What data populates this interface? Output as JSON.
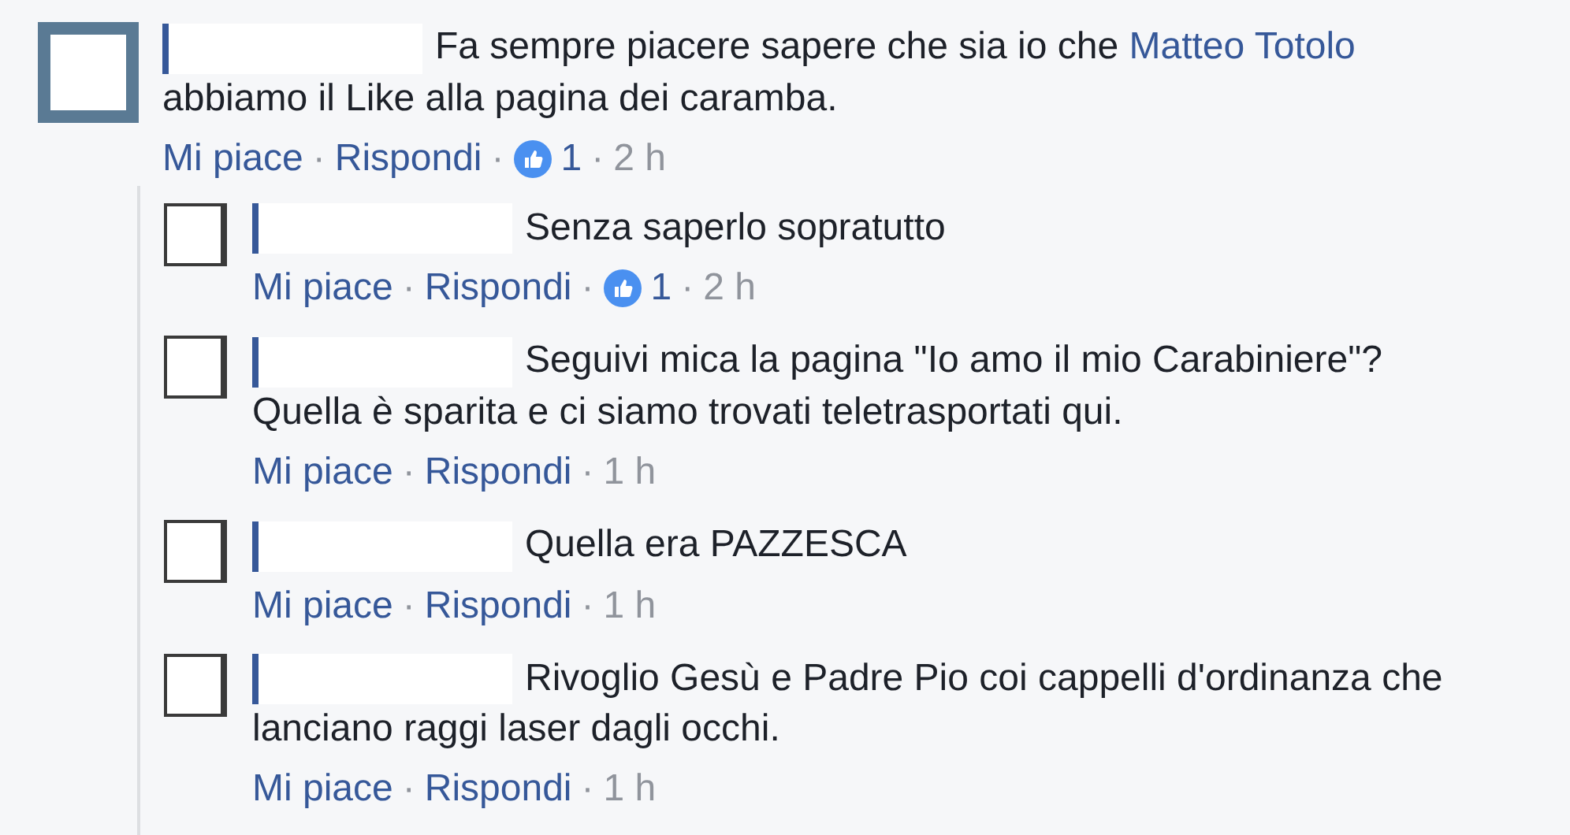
{
  "comment": {
    "author_redacted": true,
    "text": [
      {
        "kind": "plain",
        "text": "Fa sempre piacere sapere che sia io che "
      },
      {
        "kind": "mention",
        "text": "Matteo Totolo"
      },
      {
        "kind": "plain",
        "text": " abbiamo il Like alla pagina dei caramba."
      }
    ],
    "actions": [
      {
        "kind": "link",
        "text": "Mi piace"
      },
      {
        "kind": "dot",
        "text": "·"
      },
      {
        "kind": "link",
        "text": "Rispondi"
      },
      {
        "kind": "dot",
        "text": "·"
      },
      {
        "kind": "reactions",
        "text": "1"
      },
      {
        "kind": "dot",
        "text": "·"
      },
      {
        "kind": "time",
        "text": "2 h"
      }
    ],
    "replies": [
      {
        "author_redacted": true,
        "text": [
          {
            "kind": "plain",
            "text": "Senza saperlo sopratutto"
          }
        ],
        "actions": [
          {
            "kind": "link",
            "text": "Mi piace"
          },
          {
            "kind": "dot",
            "text": "·"
          },
          {
            "kind": "link",
            "text": "Rispondi"
          },
          {
            "kind": "dot",
            "text": "·"
          },
          {
            "kind": "reactions",
            "text": "1"
          },
          {
            "kind": "dot",
            "text": "·"
          },
          {
            "kind": "time",
            "text": "2 h"
          }
        ]
      },
      {
        "author_redacted": true,
        "text": [
          {
            "kind": "plain",
            "text": "Seguivi mica la pagina \"Io amo il mio Carabiniere\"? Quella è sparita e ci siamo trovati teletrasportati qui."
          }
        ],
        "actions": [
          {
            "kind": "link",
            "text": "Mi piace"
          },
          {
            "kind": "dot",
            "text": "·"
          },
          {
            "kind": "link",
            "text": "Rispondi"
          },
          {
            "kind": "dot",
            "text": "·"
          },
          {
            "kind": "time",
            "text": "1 h"
          }
        ]
      },
      {
        "author_redacted": true,
        "text": [
          {
            "kind": "plain",
            "text": "Quella era PAZZESCA"
          }
        ],
        "actions": [
          {
            "kind": "link",
            "text": "Mi piace"
          },
          {
            "kind": "dot",
            "text": "·"
          },
          {
            "kind": "link",
            "text": "Rispondi"
          },
          {
            "kind": "dot",
            "text": "·"
          },
          {
            "kind": "time",
            "text": "1 h"
          }
        ]
      },
      {
        "author_redacted": true,
        "text": [
          {
            "kind": "plain",
            "text": "Rivoglio Gesù e Padre Pio coi cappelli d'ordinanza che lanciano raggi laser dagli occhi."
          }
        ],
        "actions": [
          {
            "kind": "link",
            "text": "Mi piace"
          },
          {
            "kind": "dot",
            "text": "·"
          },
          {
            "kind": "link",
            "text": "Rispondi"
          },
          {
            "kind": "dot",
            "text": "·"
          },
          {
            "kind": "time",
            "text": "1 h"
          }
        ]
      }
    ]
  }
}
